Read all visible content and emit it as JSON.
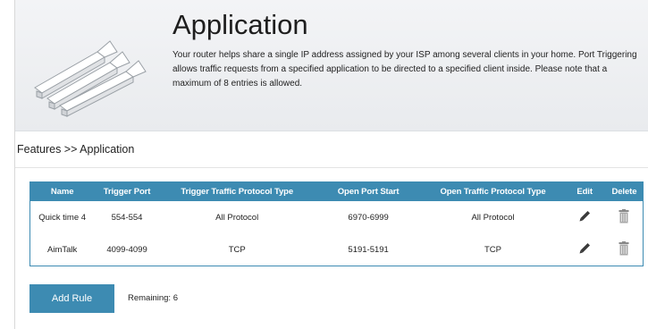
{
  "header": {
    "title": "Application",
    "description": "Your router helps share a single IP address assigned by your ISP among several clients in your home. Port Triggering allows traffic requests from a specified application to be directed to a specified client inside. Please note that a maximum of 8 entries is allowed."
  },
  "breadcrumb": "Features >> Application",
  "table": {
    "columns": [
      "Name",
      "Trigger Port",
      "Trigger Traffic Protocol Type",
      "Open Port Start",
      "Open Traffic Protocol Type",
      "Edit",
      "Delete"
    ],
    "rows": [
      {
        "name": "Quick time 4",
        "trigger_port": "554-554",
        "trigger_protocol": "All Protocol",
        "open_port": "6970-6999",
        "open_protocol": "All Protocol",
        "edit_icon": "pencil-icon",
        "delete_icon": "trash-icon"
      },
      {
        "name": "AimTalk",
        "trigger_port": "4099-4099",
        "trigger_protocol": "TCP",
        "open_port": "5191-5191",
        "open_protocol": "TCP",
        "edit_icon": "pencil-icon",
        "delete_icon": "trash-icon"
      }
    ]
  },
  "actions": {
    "add_rule_label": "Add Rule",
    "remaining_label": "Remaining: 6"
  },
  "colors": {
    "accent": "#3d8bb2",
    "hero_bg": "#eceef1"
  }
}
